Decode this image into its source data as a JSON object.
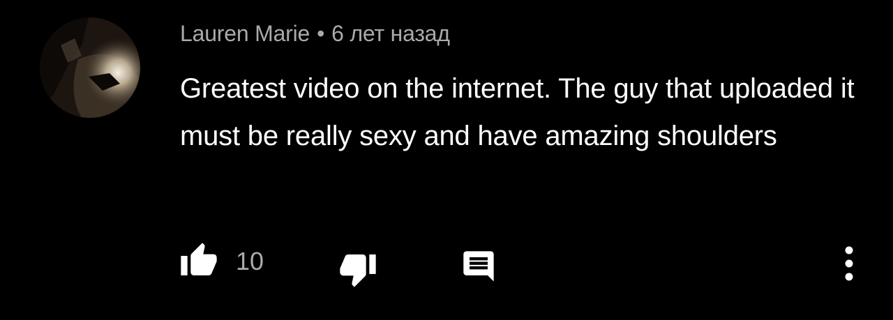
{
  "comment": {
    "author": "Lauren Marie",
    "separator": "•",
    "time": "6 лет назад",
    "text": "Greatest video on the internet. The guy that uploaded it must be really sexy and have amazing shoulders",
    "like_count": "10"
  },
  "icons": {
    "like": "thumbs-up-icon",
    "dislike": "thumbs-down-icon",
    "reply": "comment-reply-icon",
    "more": "vertical-dots-icon"
  },
  "colors": {
    "background": "#000000",
    "text": "#ffffff",
    "secondary": "#aaaaaa",
    "icon": "#ffffff"
  }
}
